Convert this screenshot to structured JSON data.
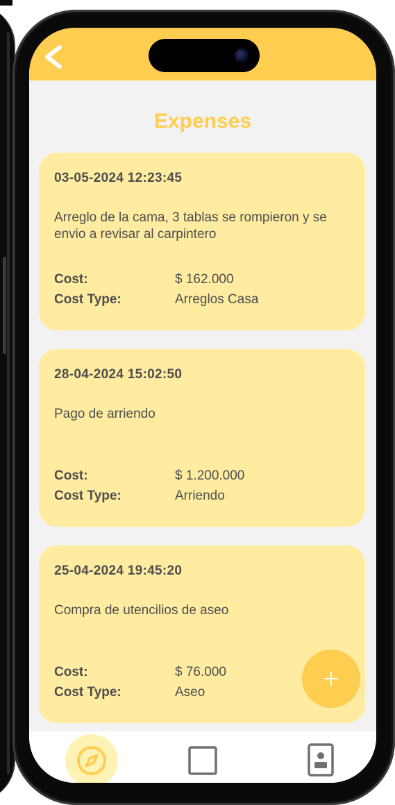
{
  "header": {
    "back_icon": "chevron-left-icon",
    "title": "Expenses"
  },
  "colors": {
    "accent": "#ffcd4f",
    "card_background": "#ffeca1",
    "screen_background": "#f2f2f2",
    "text": "#4e4e4e"
  },
  "expenses": [
    {
      "date": "03-05-2024 12:23:45",
      "description": "Arreglo de la cama, 3 tablas se rompieron y se envio a revisar al carpintero",
      "cost_label": "Cost:",
      "cost": "$ 162.000",
      "type_label": "Cost Type:",
      "type": "Arreglos Casa"
    },
    {
      "date": "28-04-2024 15:02:50",
      "description": "Pago de arriendo",
      "cost_label": "Cost:",
      "cost": "$ 1.200.000",
      "type_label": "Cost Type:",
      "type": "Arriendo"
    },
    {
      "date": "25-04-2024 19:45:20",
      "description": "Compra de utencilios de aseo",
      "cost_label": "Cost:",
      "cost": "$ 76.000",
      "type_label": "Cost Type:",
      "type": "Aseo"
    }
  ],
  "fab": {
    "icon": "plus-icon"
  },
  "bottom_nav": [
    {
      "icon": "compass-icon",
      "active": true
    },
    {
      "icon": "square-icon",
      "active": false
    },
    {
      "icon": "contact-card-icon",
      "active": false
    }
  ]
}
